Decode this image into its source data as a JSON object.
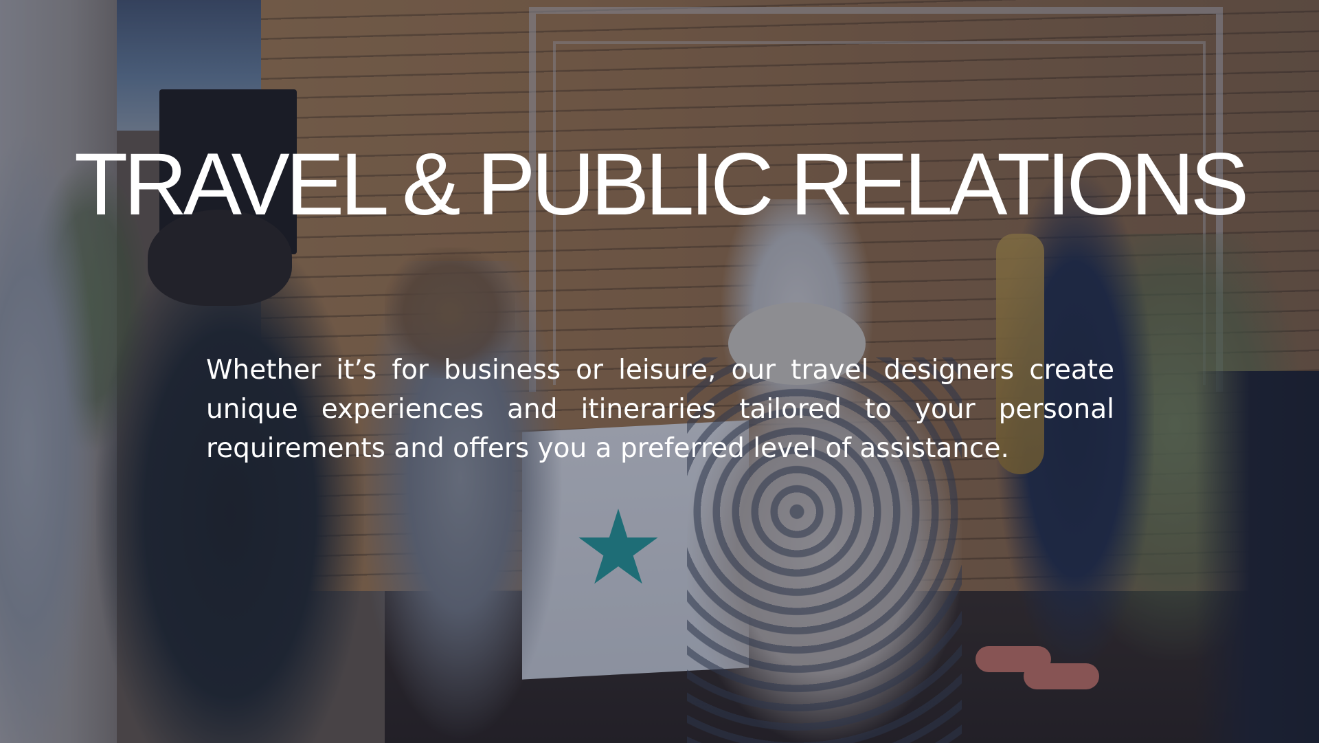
{
  "slide": {
    "title": "TRAVEL & PUBLIC RELATIONS",
    "body": "Whether it’s for business or leisure, our travel designers create unique experiences and itineraries tailored to your personal requirements and offers you a preferred level of assistance."
  },
  "background": {
    "description_icon": "event-photo-background",
    "overlay_color": "#1e2240"
  },
  "colors": {
    "text": "#ffffff",
    "logo_star": "#23a6a4"
  }
}
